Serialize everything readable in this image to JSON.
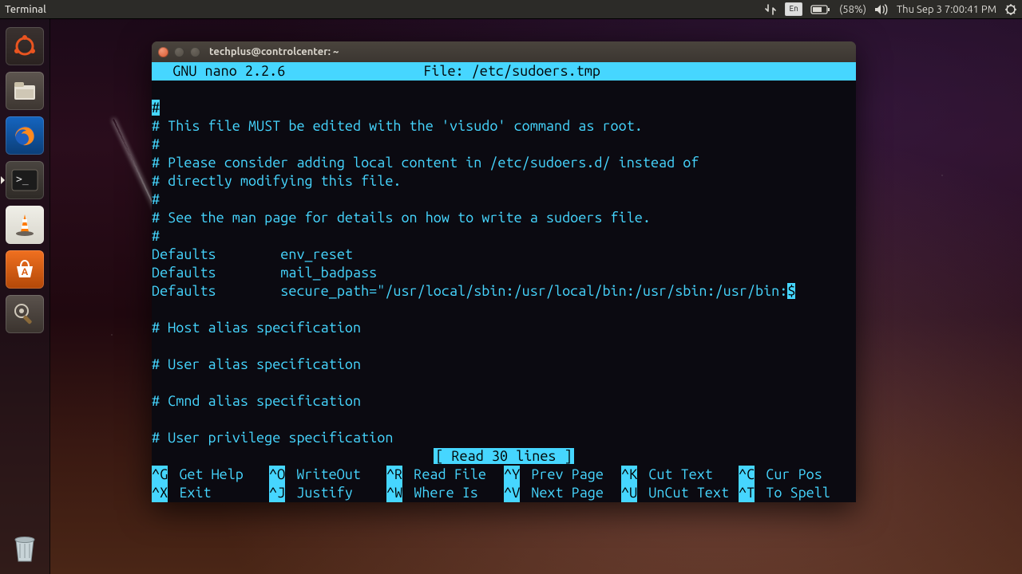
{
  "panel": {
    "app_label": "Terminal",
    "keyboard": "En",
    "battery": "(58%)",
    "clock": "Thu Sep  3  7:00:41 PM"
  },
  "launcher": {
    "items": [
      {
        "name": "dash",
        "icon": "ubuntu"
      },
      {
        "name": "files",
        "icon": "folder"
      },
      {
        "name": "firefox",
        "icon": "firefox"
      },
      {
        "name": "terminal",
        "icon": "terminal",
        "running": true
      },
      {
        "name": "vlc",
        "icon": "cone"
      },
      {
        "name": "software-center",
        "icon": "bag"
      },
      {
        "name": "settings",
        "icon": "wrench"
      }
    ],
    "trash": "trash"
  },
  "window": {
    "title": "techplus@controlcenter: ~"
  },
  "nano": {
    "header_left": "  GNU nano 2.2.6",
    "header_file": "File: /etc/sudoers.tmp",
    "lines": [
      "#",
      "# This file MUST be edited with the 'visudo' command as root.",
      "#",
      "# Please consider adding local content in /etc/sudoers.d/ instead of",
      "# directly modifying this file.",
      "#",
      "# See the man page for details on how to write a sudoers file.",
      "#",
      "Defaults        env_reset",
      "Defaults        mail_badpass",
      "Defaults        secure_path=\"/usr/local/sbin:/usr/local/bin:/usr/sbin:/usr/bin:",
      "",
      "# Host alias specification",
      "",
      "# User alias specification",
      "",
      "# Cmnd alias specification",
      "",
      "# User privilege specification"
    ],
    "truncated_line_index": 10,
    "status": "[ Read 30 lines ]",
    "help": [
      {
        "k": "^G",
        "l": "Get Help"
      },
      {
        "k": "^O",
        "l": "WriteOut"
      },
      {
        "k": "^R",
        "l": "Read File"
      },
      {
        "k": "^Y",
        "l": "Prev Page"
      },
      {
        "k": "^K",
        "l": "Cut Text"
      },
      {
        "k": "^C",
        "l": "Cur Pos"
      },
      {
        "k": "^X",
        "l": "Exit"
      },
      {
        "k": "^J",
        "l": "Justify"
      },
      {
        "k": "^W",
        "l": "Where Is"
      },
      {
        "k": "^V",
        "l": "Next Page"
      },
      {
        "k": "^U",
        "l": "UnCut Text"
      },
      {
        "k": "^T",
        "l": "To Spell"
      }
    ]
  }
}
